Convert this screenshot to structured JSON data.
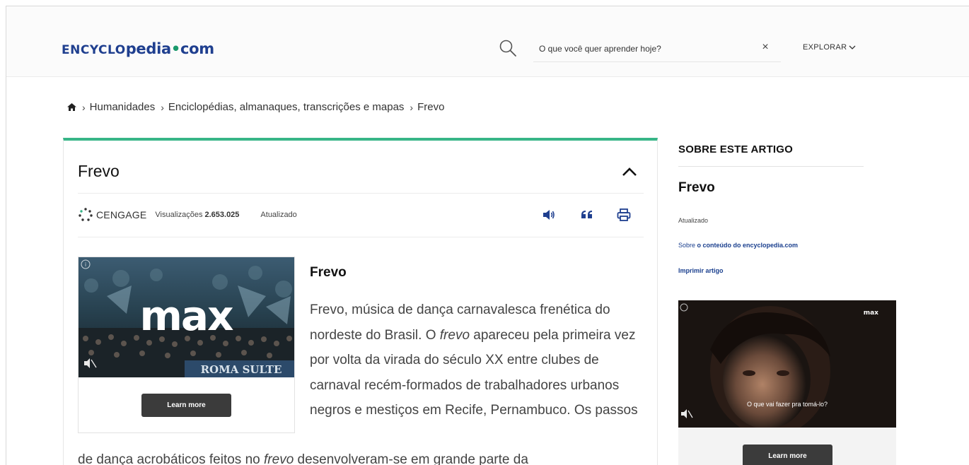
{
  "header": {
    "logo_prefix": "ENCYCLO",
    "logo_mid": "pedia",
    "logo_dot": "•",
    "logo_suffix": "com",
    "search_placeholder": "O que você quer aprender hoje?",
    "clear_symbol": "×",
    "explore_label": "EXPLORAR"
  },
  "breadcrumb": {
    "home_icon": "home-icon",
    "items": [
      "Humanidades",
      "Enciclopédias, almanaques, transcrições e mapas",
      "Frevo"
    ],
    "separator": "›"
  },
  "article": {
    "title": "Frevo",
    "publisher": "CENGAGE",
    "views_label": "Visualizações",
    "views_count": "2.653.025",
    "updated_label": "Atualizado",
    "tools": [
      "speaker-icon",
      "quote-icon",
      "print-icon"
    ],
    "heading": "Frevo",
    "para_1_a": "Frevo, música de dança carnavalesca frenética do nordeste do Brasil. O ",
    "para_1_em": "frevo",
    "para_1_b": " apareceu pela primeira vez por volta da virada do século XX entre clubes de carnaval recém-formados de trabalhadores urbanos negros e mestiços em Recife, Pernambuco. Os passos",
    "para_2_a": "de dança acrobáticos feitos no ",
    "para_2_em": "frevo",
    "para_2_b": " desenvolveram-se em grande parte da"
  },
  "ad_left": {
    "brand": "max",
    "banner_text": "ROMA SULTE",
    "button_label": "Learn more"
  },
  "sidebar": {
    "section_title": "SOBRE ESTE ARTIGO",
    "article_name": "Frevo",
    "updated_label": "Atualizado",
    "about_prefix": "Sobre ",
    "about_link": "o conteúdo do encyclopedia.com",
    "print_label": "Imprimir artigo",
    "ad": {
      "brand": "max",
      "caption": "O que vai fazer pra tomá-lo?",
      "button_label": "Learn more"
    }
  },
  "colors": {
    "brand_blue": "#1f3f8f",
    "accent_green": "#37b587",
    "link_blue": "#1a3f8e",
    "button_dark": "#3b3b3b"
  }
}
